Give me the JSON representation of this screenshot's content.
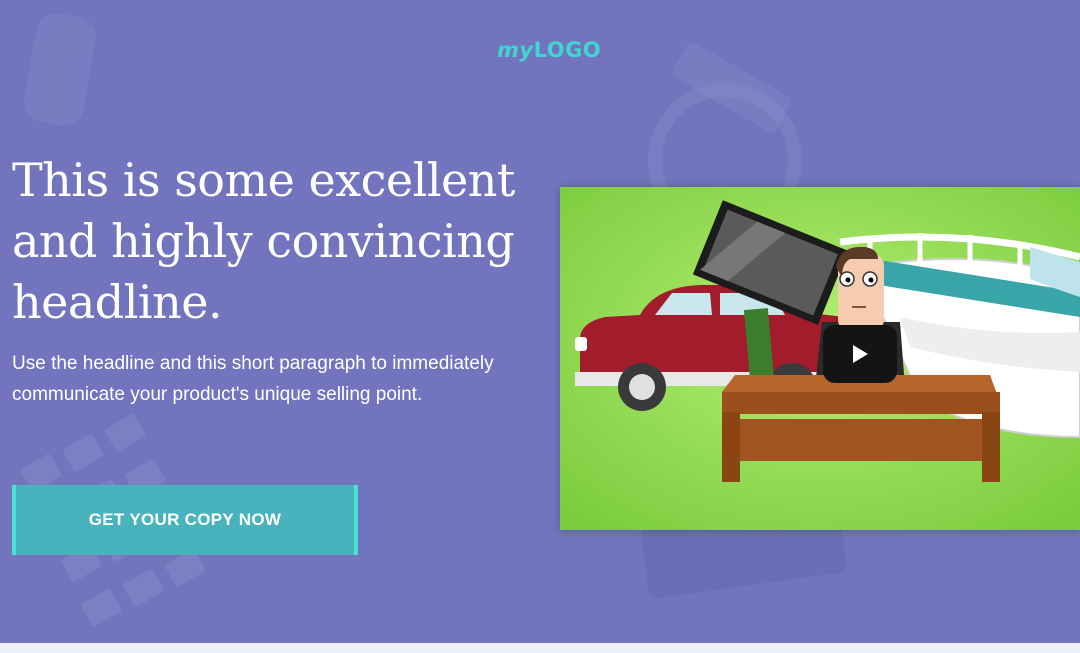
{
  "logo": {
    "prefix": "my",
    "suffix": "LOGO"
  },
  "hero": {
    "headline": "This is some excellent and highly convincing headline.",
    "paragraph": "Use the headline and this short paragraph to immediately communicate your product's unique selling point.",
    "cta_label": "GET YOUR COPY NOW"
  },
  "colors": {
    "hero_background": "#7275bd",
    "logo": "#3fd6cf",
    "cta_background": "#49b3bd",
    "cta_border": "#46e3d2",
    "video_background": "#87d850"
  },
  "video": {
    "play_icon": "play-icon"
  }
}
